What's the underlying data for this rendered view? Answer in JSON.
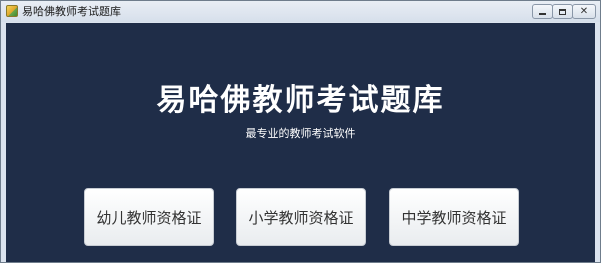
{
  "window": {
    "title": "易哈佛教师考试题库",
    "icon": "app-icon",
    "controls": {
      "minimize_icon": "minimize-icon",
      "maximize_icon": "maximize-icon",
      "close_icon": "close-icon"
    }
  },
  "main": {
    "title": "易哈佛教师考试题库",
    "subtitle": "最专业的教师考试软件",
    "background_color": "#1f2d48",
    "buttons": [
      {
        "label": "幼儿教师资格证"
      },
      {
        "label": "小学教师资格证"
      },
      {
        "label": "中学教师资格证"
      }
    ]
  }
}
